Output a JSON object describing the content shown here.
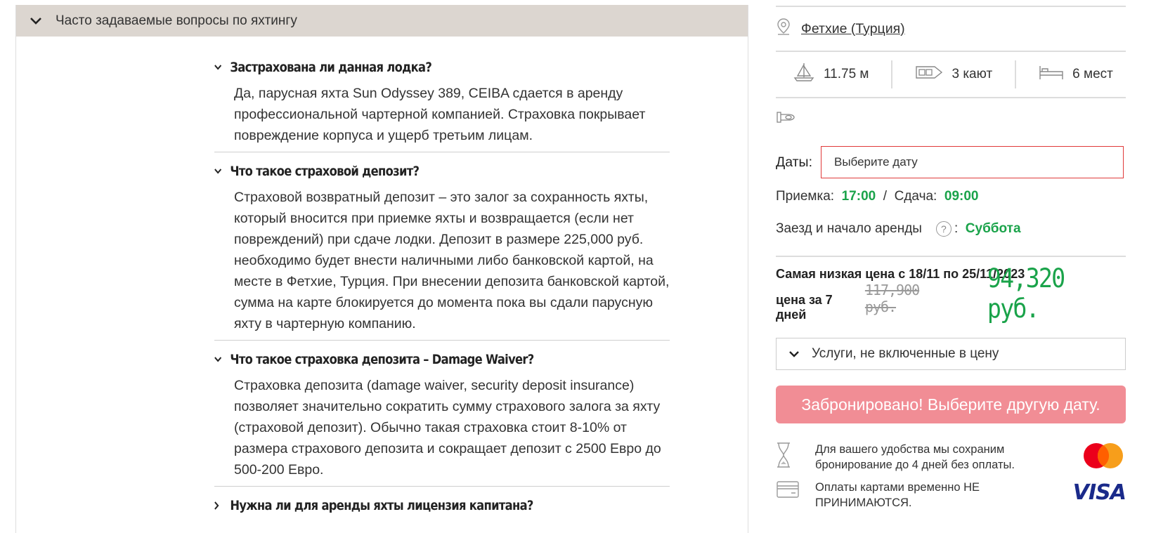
{
  "faq": {
    "header": "Часто задаваемые вопросы по яхтингу",
    "items": [
      {
        "question": "Застрахована ли данная лодка?",
        "answer": "Да, парусная яхта Sun Odyssey 389, CEIBA сдается в аренду профессиональной чартерной компанией. Страховка покрывает повреждение корпуса и ущерб третьим лицам.",
        "expanded": true
      },
      {
        "question": "Что такое страховой депозит?",
        "answer": "Страховой возвратный депозит – это залог за сохранность яхты, который вносится при приемке яхты и возвращается (если нет повреждений) при сдаче лодки. Депозит в размере 225,000 руб. необходимо будет внести наличными либо банковской картой, на месте в Фетхие, Турция. При внесении депозита банковской картой, сумма на карте блокируется до момента пока вы сдали парусную яхту в чартерную компанию.",
        "expanded": true
      },
      {
        "question": "Что такое страховка депозита – Damage Waiver?",
        "answer": "Страховка депозита (damage waiver, security deposit insurance) позволяет значительно сократить сумму страхового залога за яхту (страховой депозит). Обычно такая страховка стоит 8-10% от размера страхового депозита и сокращает депозит с 2500 Евро до 500-200 Евро.",
        "expanded": true
      },
      {
        "question": "Нужна ли для аренды яхты лицензия капитана?",
        "answer": "",
        "expanded": false
      }
    ]
  },
  "yacht": {
    "location": "Фетхие (Турция)",
    "length": "11.75 м",
    "cabins": "3 кают",
    "berths": "6 мест"
  },
  "booking": {
    "dates_label": "Даты:",
    "date_placeholder": "Выберите дату",
    "checkin_label": "Приемка:",
    "checkin_time": "17:00",
    "separator": "/",
    "checkout_label": "Сдача:",
    "checkout_time": "09:00",
    "start_label": "Заезд и начало аренды",
    "start_help": "?",
    "start_colon": ":",
    "start_day": "Суббота",
    "lowest_price_text": "Самая низкая цена с 18/11 по 25/11/2023",
    "price_label": "цена за 7 дней",
    "old_price": "117,900 руб.",
    "new_price": "94,320 руб.",
    "services_label": "Услуги, не включенные в цену",
    "book_button": "Забронировано! Выберите другую дату.",
    "hold_note": "Для вашего удобства мы сохраним бронирование до 4 дней без оплаты.",
    "card_note": "Оплаты картами временно НЕ ПРИНИМАЮТСЯ.",
    "visa_text": "VISA"
  },
  "colors": {
    "accent_green": "#1aa34a",
    "button_pink": "#f18d95",
    "error_red": "#e03a3a",
    "header_bg": "#dcd6d0"
  }
}
